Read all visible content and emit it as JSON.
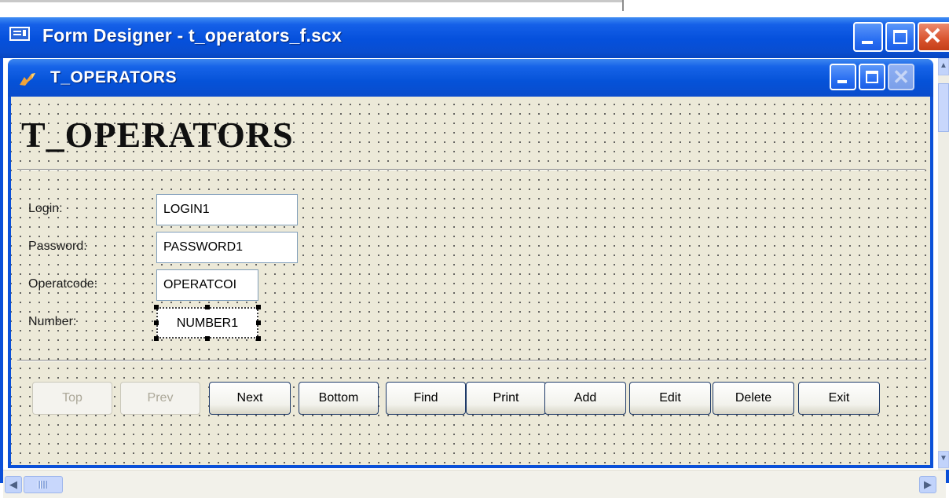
{
  "outer_window": {
    "title": "Form Designer - t_operators_f.scx"
  },
  "inner_window": {
    "title": "T_OPERATORS"
  },
  "form": {
    "heading": "T_OPERATORS",
    "fields": [
      {
        "label": "Login:",
        "value": "LOGIN1"
      },
      {
        "label": "Password:",
        "value": "PASSWORD1"
      },
      {
        "label": "Operatcode:",
        "value": "OPERATCOI"
      },
      {
        "label": "Number:",
        "value": "NUMBER1"
      }
    ],
    "buttons": {
      "top": "Top",
      "prev": "Prev",
      "next": "Next",
      "bottom": "Bottom",
      "find": "Find",
      "print": "Print",
      "add": "Add",
      "edit": "Edit",
      "delete": "Delete",
      "exit": "Exit"
    }
  },
  "colors": {
    "title_bar": "#0550dc",
    "canvas": "#ece9d8",
    "close_button": "#d8532d"
  }
}
